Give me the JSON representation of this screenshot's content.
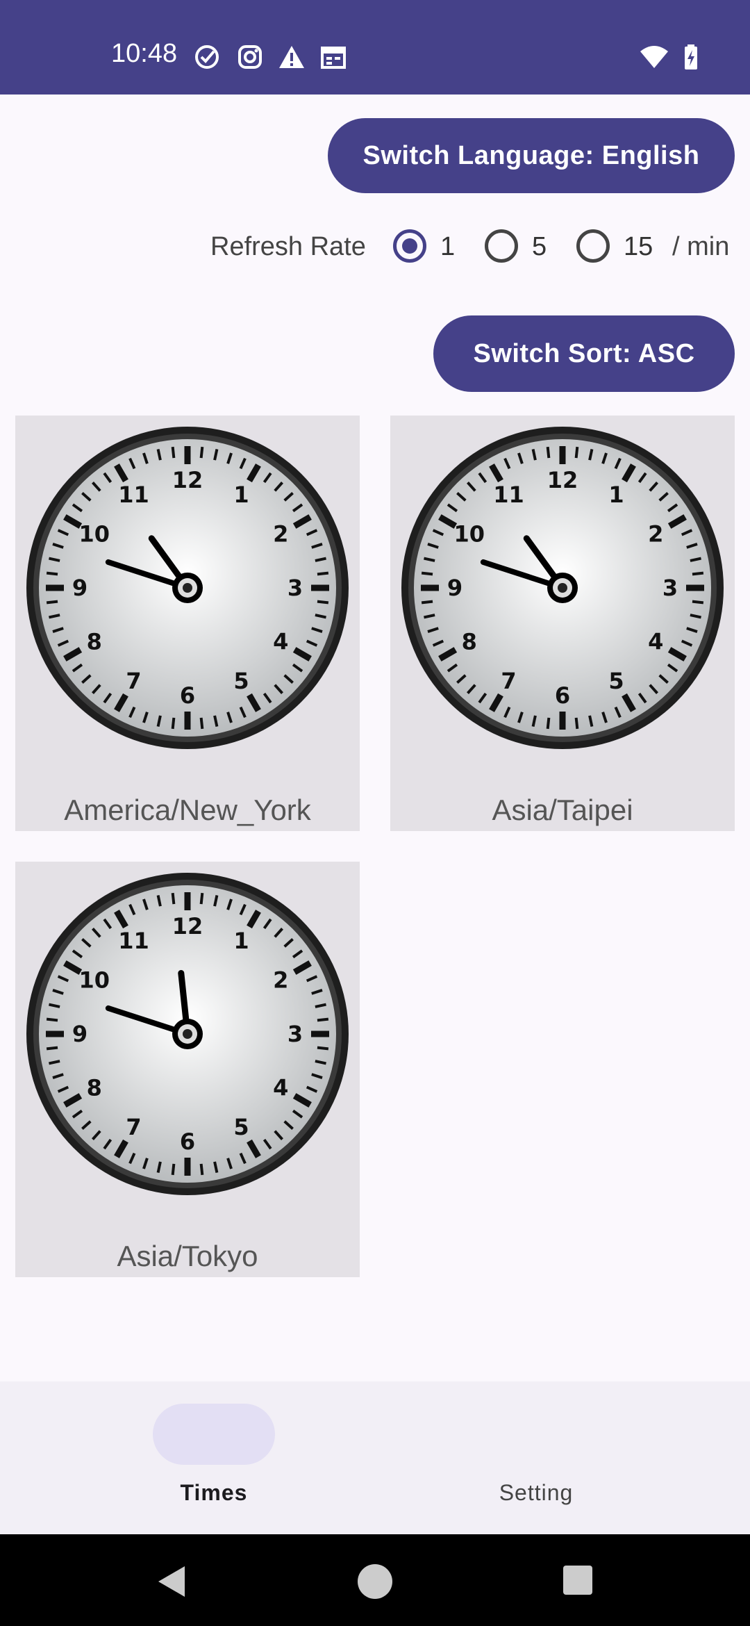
{
  "status_bar": {
    "time": "10:48",
    "icons": [
      "check-circle-icon",
      "instagram-icon",
      "warning-icon",
      "calendar-icon",
      "wifi-icon",
      "battery-charging-icon"
    ]
  },
  "controls": {
    "switch_language": "Switch Language: English",
    "refresh_label": "Refresh Rate",
    "refresh_options": [
      "1",
      "5",
      "15"
    ],
    "refresh_selected": "1",
    "refresh_unit": "/ min",
    "switch_sort": "Switch Sort: ASC"
  },
  "clocks": [
    {
      "zone": "America/New_York",
      "hour": 10,
      "minute": 48
    },
    {
      "zone": "Asia/Taipei",
      "hour": 10,
      "minute": 48
    },
    {
      "zone": "Asia/Tokyo",
      "hour": 11,
      "minute": 48
    }
  ],
  "bottom_nav": {
    "items": [
      {
        "label": "Times",
        "active": true
      },
      {
        "label": "Setting",
        "active": false
      }
    ]
  },
  "colors": {
    "primary": "#454189",
    "background": "#fbf8fd",
    "card": "#e4e1e6"
  }
}
